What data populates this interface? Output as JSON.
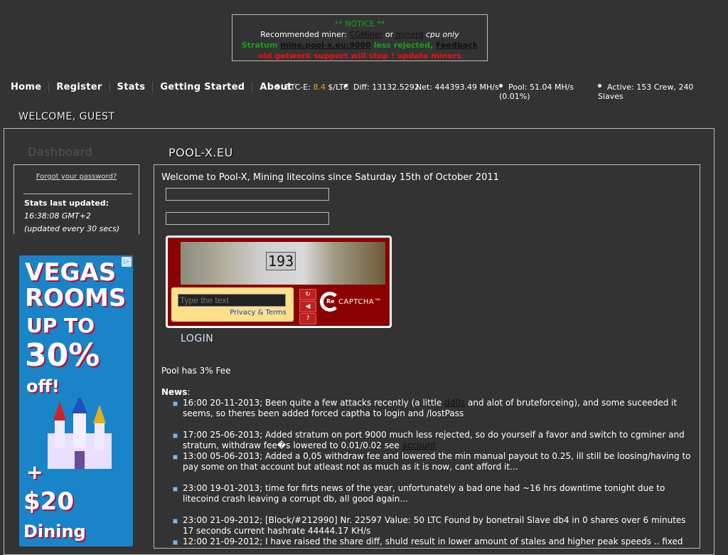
{
  "notice": {
    "title": "** NOTICE **",
    "recommended_prefix": "Recommended miner: ",
    "miner1": "CGMiner",
    "or": " or ",
    "miner2": "minerd",
    "cpu_only": " cpu only",
    "stratum_label": "Stratum ",
    "stratum_host": "mine.pool-x.eu:9000",
    "stratum_suffix": " less rejected, ",
    "feedback": "Feedback",
    "warning": "old getwork support will stop ! update miners"
  },
  "nav": {
    "items": [
      "Home",
      "Register",
      "Stats",
      "Getting Started",
      "About"
    ]
  },
  "stats": {
    "btce_label": "BTC-E: ",
    "btce_value": "8.4",
    "btce_unit": " $/LTC",
    "diff": "Diff: 13132.5292",
    "net": "Net: 444393.49 MH/s",
    "pool_line1": "Pool: 51.04 MH/s",
    "pool_line2": "(0.01%)",
    "active_line1": "Active: 153 Crew, 240",
    "active_line2": "Slaves"
  },
  "welcome": "WELCOME, GUEST",
  "sidebar": {
    "title": "Dashboard",
    "forgot": "Forgot your password?",
    "stats_head": "Stats last updated:",
    "stats_time": "16:38:08 GMT+2",
    "stats_note": "(updated every 30 secs)"
  },
  "ad": {
    "line1": "VEGAS",
    "line2": "ROOMS",
    "line3": "UP TO",
    "line4": "30%",
    "line5": "off!",
    "line6": "+",
    "line7": "$20",
    "line8": "Dining",
    "choice": "▷"
  },
  "main": {
    "title": "POOL-X.EU",
    "intro": "Welcome to Pool-X, Mining litecoins since Saturday 15th of October 2011",
    "login": "LOGIN",
    "fee": "Pool has 3% Fee",
    "news_label": "News",
    "news_colon": ":"
  },
  "captcha": {
    "number": "193",
    "placeholder": "Type the text",
    "privacy": "Privacy & Terms",
    "btn_refresh": "↻",
    "btn_audio": "◀",
    "btn_help": "?",
    "logo_re": "Re",
    "logo_text": "CAPTCHA™"
  },
  "news": [
    {
      "pre": "16:00 20-11-2013; Been quite a few attacks recently (a little ",
      "link": "dd0s",
      "post": " and alot of bruteforceing), and some suceeded it seems, so theres been added forced captha to login and /lostPass"
    },
    {
      "pre": "17:00 25-06-2013; Added stratum on port 9000 much less rejected, so do yourself a favor and switch to cgminer and stratum, withdraw fee�s lowered to 0.01/0.02 see ",
      "link": "account",
      "post": ""
    },
    {
      "pre": "13:00 05-06-2013; Added a 0,05 withdraw fee and lowered the min manual payout to 0.25, ill still be loosing/having to pay some on that account but atleast not as much as it is now, cant afford it...",
      "link": "",
      "post": ""
    },
    {
      "pre": "23:00 19-01-2013; time for firts news of the year, unfortunately a bad one had ~16 hrs downtime tonight due to litecoind crash leaving a corrupt db, all good again...",
      "link": "",
      "post": ""
    },
    {
      "pre": "23:00 21-09-2012; [Block/#212990] Nr. 22597 Value: 50 LTC Found by bonetrail Slave db4 in 0 shares over 6 minutes 17 seconds current hashrate 44444.17 KH/s",
      "link": "",
      "post": ""
    },
    {
      "pre": "12:00 21-09-2012; I have raised the share diff, shuld result in lower amount of stales and higher peak speeds .. fixed",
      "link": "",
      "post": ""
    }
  ]
}
